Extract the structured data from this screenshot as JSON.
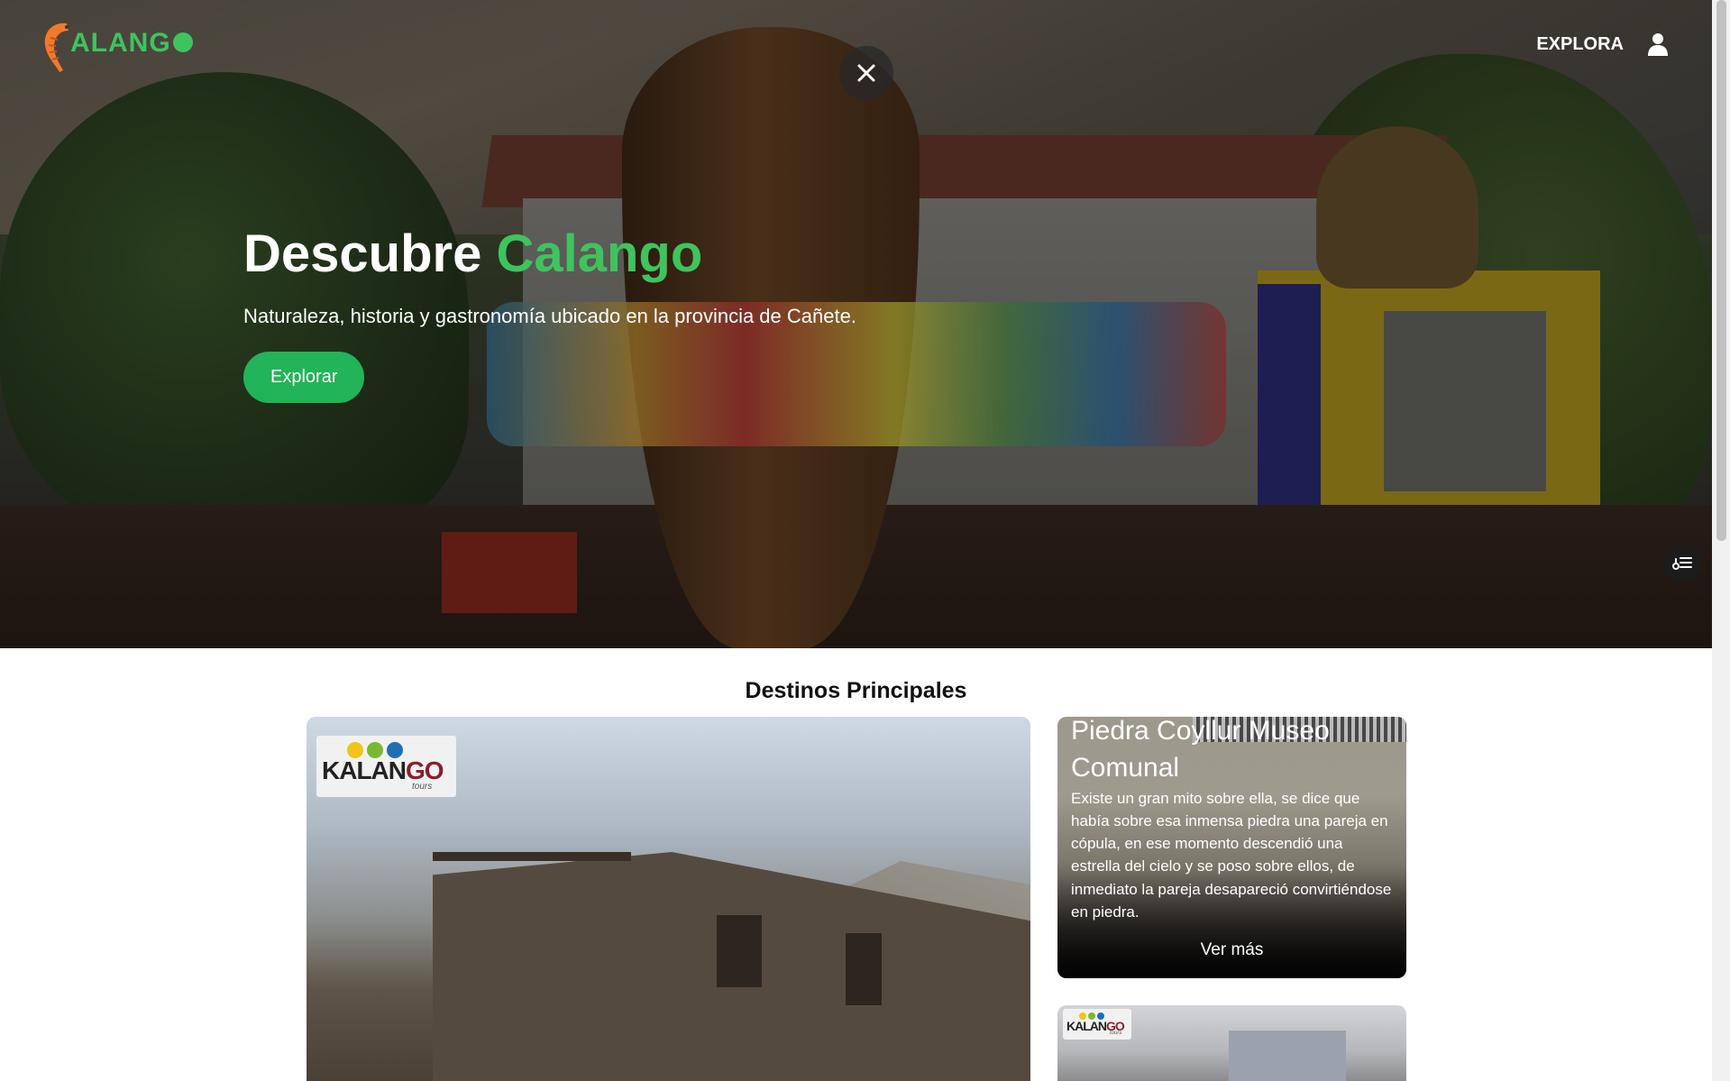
{
  "nav": {
    "logo_text": "ALANG",
    "explore_label": "EXPLORA"
  },
  "hero": {
    "title_prefix": "Descubre",
    "title_accent": "Calango",
    "subtitle": "Naturaleza, historia y gastronomía ubicado en la provincia de Cañete.",
    "cta_label": "Explorar"
  },
  "section": {
    "title": "Destinos Principales"
  },
  "destinations": [
    {
      "badge_text": "KALAN",
      "badge_text_accent": "GO",
      "badge_sub": "tours"
    },
    {
      "title": "Piedra Coyllur Museo Comunal",
      "description": "Existe un gran mito sobre ella, se dice que había sobre esa inmensa piedra una pareja en cópula, en ese momento descendió una estrella del cielo y se poso sobre ellos, de inmediato la pareja desapareció convirtiéndose en piedra.",
      "link_label": "Ver más"
    },
    {
      "badge_text": "KALAN",
      "badge_text_accent": "GO",
      "badge_sub": "tours"
    }
  ],
  "colors": {
    "accent_green": "#3ec45d",
    "button_green": "#22b458",
    "badge_dot_1": "#f0c419",
    "badge_dot_2": "#7ab834",
    "badge_dot_3": "#1f6fb4"
  },
  "icons": {
    "close": "close-icon",
    "user": "user-icon",
    "filter": "filter-list-icon",
    "logo_shrimp": "shrimp-icon"
  }
}
